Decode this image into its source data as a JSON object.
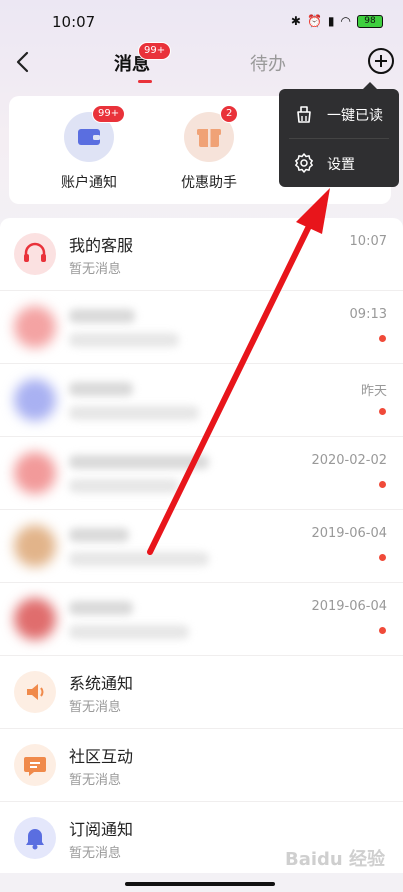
{
  "status_bar": {
    "time": "10:07",
    "battery": "98"
  },
  "nav": {
    "tab_messages": "消息",
    "tab_messages_badge": "99+",
    "tab_todo": "待办"
  },
  "quick": [
    {
      "label": "账户通知",
      "badge": "99+"
    },
    {
      "label": "优惠助手",
      "badge": "2"
    }
  ],
  "menu": {
    "mark_all_read": "一键已读",
    "settings": "设置"
  },
  "rows": {
    "service": {
      "title": "我的客服",
      "sub": "暂无消息",
      "time": "10:07"
    },
    "r1": {
      "time": "09:13"
    },
    "r2": {
      "time": "昨天"
    },
    "r3": {
      "time": "2020-02-02"
    },
    "r4": {
      "time": "2019-06-04"
    },
    "r5": {
      "time": "2019-06-04"
    },
    "system": {
      "title": "系统通知",
      "sub": "暂无消息"
    },
    "community": {
      "title": "社区互动",
      "sub": "暂无消息"
    },
    "subscribe": {
      "title": "订阅通知",
      "sub": "暂无消息"
    }
  },
  "colors": {
    "accent": "#e9323a",
    "unread_dot": "#f04a39",
    "annotation_arrow": "#e8151b"
  },
  "watermark": "Baidu 经验"
}
